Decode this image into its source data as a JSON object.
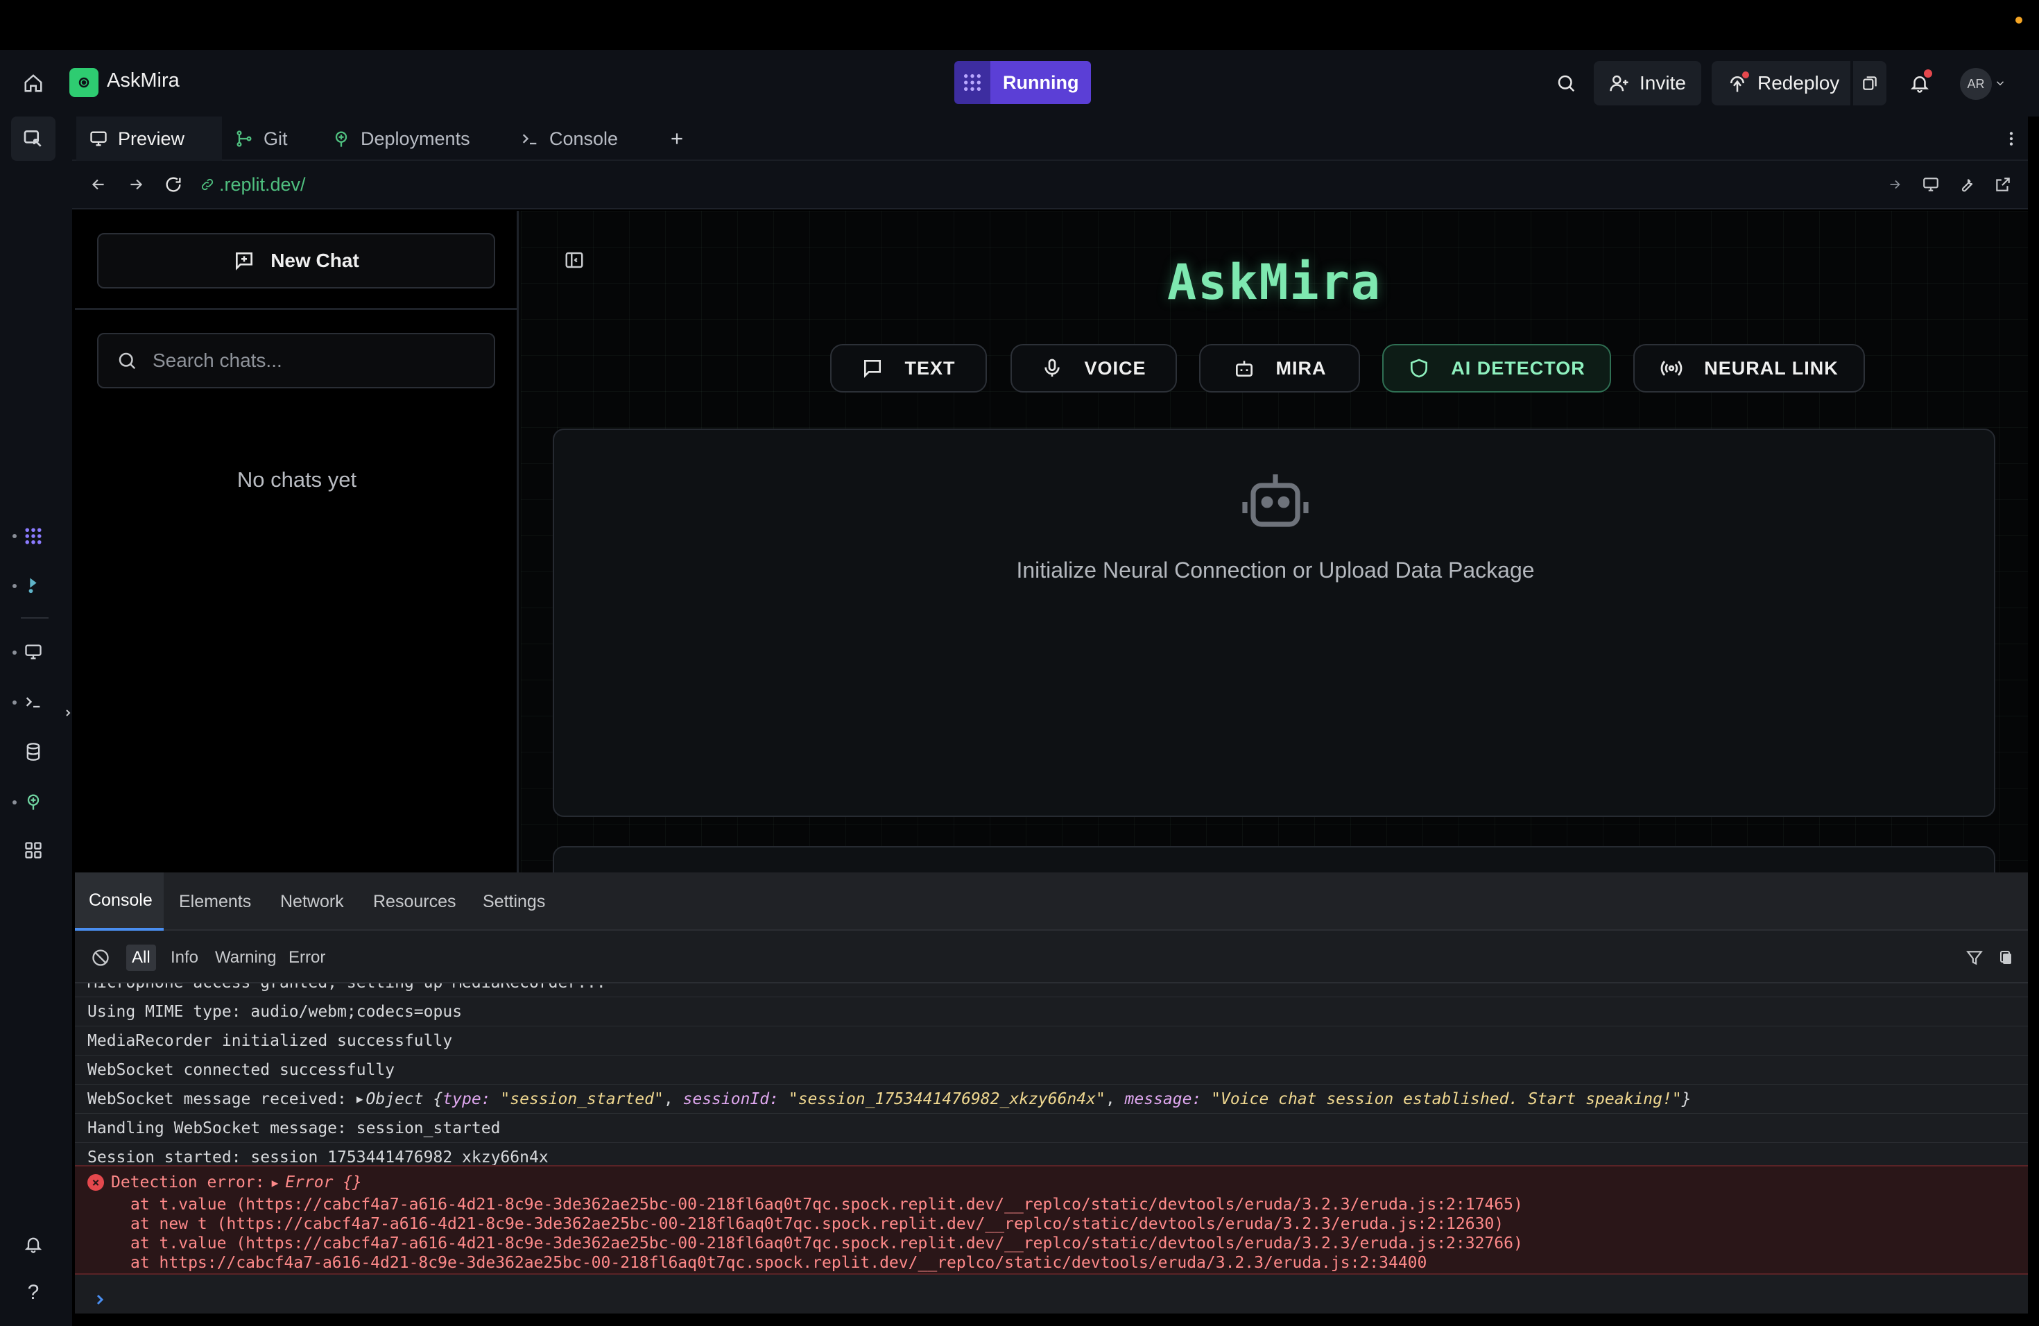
{
  "header": {
    "app_name": "AskMira",
    "status": "Running",
    "invite_label": "Invite",
    "redeploy_label": "Redeploy",
    "avatar_initials": "AR"
  },
  "tabs": [
    {
      "label": "Preview",
      "icon": "monitor-icon",
      "active": true
    },
    {
      "label": "Git",
      "icon": "git-branch-icon"
    },
    {
      "label": "Deployments",
      "icon": "deploy-icon"
    },
    {
      "label": "Console",
      "icon": "terminal-icon"
    }
  ],
  "url_bar": {
    "url": ".replit.dev/"
  },
  "chat_sidebar": {
    "new_chat_label": "New Chat",
    "search_placeholder": "Search chats...",
    "empty_text": "No chats yet"
  },
  "main": {
    "title": "AskMira",
    "modes": [
      {
        "label": "TEXT",
        "icon": "message-square-icon"
      },
      {
        "label": "VOICE",
        "icon": "microphone-icon"
      },
      {
        "label": "MIRA",
        "icon": "bot-icon"
      },
      {
        "label": "AI DETECTOR",
        "icon": "shield-icon",
        "active": true
      },
      {
        "label": "NEURAL LINK",
        "icon": "radio-waves-icon"
      }
    ],
    "drop_text": "Initialize Neural Connection or Upload Data Package"
  },
  "devtools": {
    "tabs": [
      "Console",
      "Elements",
      "Network",
      "Resources",
      "Settings"
    ],
    "filters": [
      "All",
      "Info",
      "Warning",
      "Error"
    ],
    "logs": [
      "Microphone access granted, setting up MediaRecorder...",
      "Using MIME type: audio/webm;codecs=opus",
      "MediaRecorder initialized successfully",
      "WebSocket connected successfully",
      "WebSocket message received: ",
      "Handling WebSocket message: session_started",
      "Session started: session_1753441476982_xkzy66n4x"
    ],
    "ws_object": {
      "prefix": "Object {",
      "type_key": "type:",
      "type_val": "\"session_started\"",
      "sid_key": "sessionId:",
      "sid_val": "\"session_1753441476982_xkzy66n4x\"",
      "msg_key": "message:",
      "msg_val": "\"Voice chat session established. Start speaking!\"",
      "suffix": "}"
    },
    "error": {
      "label": "Detection error: ",
      "object": "Error {}",
      "stack": [
        "at t.value (https://cabcf4a7-a616-4d21-8c9e-3de362ae25bc-00-218fl6aq0t7qc.spock.replit.dev/__replco/static/devtools/eruda/3.2.3/eruda.js:2:17465)",
        "at new t (https://cabcf4a7-a616-4d21-8c9e-3de362ae25bc-00-218fl6aq0t7qc.spock.replit.dev/__replco/static/devtools/eruda/3.2.3/eruda.js:2:12630)",
        "at t.value (https://cabcf4a7-a616-4d21-8c9e-3de362ae25bc-00-218fl6aq0t7qc.spock.replit.dev/__replco/static/devtools/eruda/3.2.3/eruda.js:2:32766)",
        "at https://cabcf4a7-a616-4d21-8c9e-3de362ae25bc-00-218fl6aq0t7qc.spock.replit.dev/__replco/static/devtools/eruda/3.2.3/eruda.js:2:34400"
      ]
    }
  },
  "colors": {
    "accent_green": "#7ee8b0",
    "running_purple": "#5b3fd6",
    "error_red": "#ff8a8a"
  }
}
